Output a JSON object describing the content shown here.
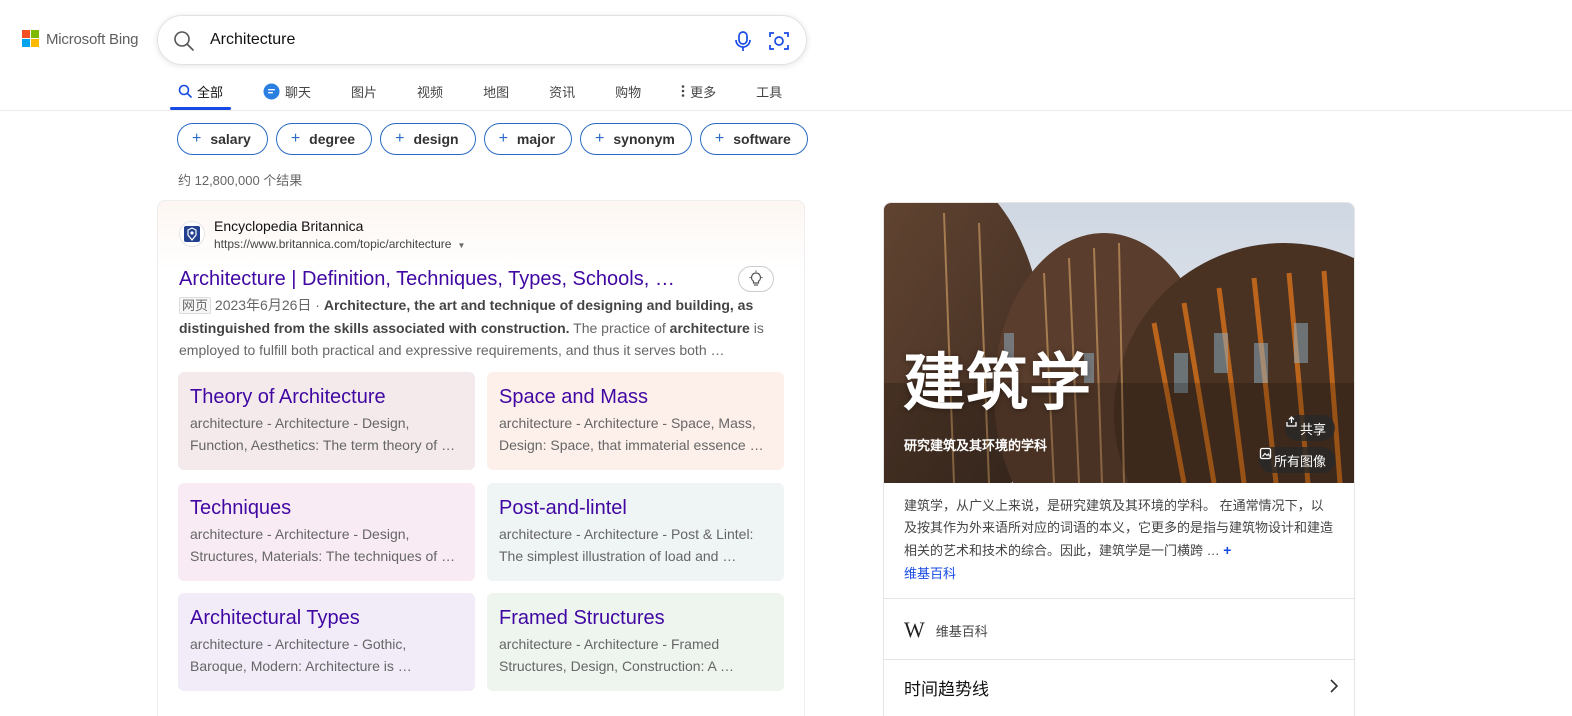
{
  "header": {
    "logo_text": "Microsoft Bing",
    "search_query": "Architecture"
  },
  "tabs": [
    {
      "label": "全部",
      "active": true,
      "icon": "search-icon"
    },
    {
      "label": "聊天",
      "active": false,
      "icon": "copilot-chat-icon"
    },
    {
      "label": "图片",
      "active": false
    },
    {
      "label": "视频",
      "active": false
    },
    {
      "label": "地图",
      "active": false
    },
    {
      "label": "资讯",
      "active": false
    },
    {
      "label": "购物",
      "active": false
    },
    {
      "label": "更多",
      "active": false,
      "icon": "more-vertical-icon"
    },
    {
      "label": "工具",
      "active": false
    }
  ],
  "refinements": [
    "salary",
    "degree",
    "design",
    "major",
    "synonym",
    "software"
  ],
  "result_count": "约 12,800,000 个结果",
  "result": {
    "site_name": "Encyclopedia Britannica",
    "url": "https://www.britannica.com/topic/architecture",
    "title": "Architecture | Definition, Techniques, Types, Schools, …",
    "label": "网页",
    "date": "2023年6月26日 ·",
    "snippet_bold": "Architecture, the art and technique of designing and building, as distinguished from the skills associated with construction.",
    "snippet_text1": "The practice of",
    "snippet_bold2": "architecture",
    "snippet_text2": "is employed to fulfill both practical and expressive requirements, and thus it serves both …",
    "deeplinks": [
      {
        "title": "Theory of Architecture",
        "desc1": "architecture - Architecture - Design,",
        "desc2": "Function, Aesthetics: The term theory of …"
      },
      {
        "title": "Space and Mass",
        "desc1": "architecture - Architecture - Space, Mass,",
        "desc2": "Design: Space, that immaterial essence …"
      },
      {
        "title": "Techniques",
        "desc1": "architecture - Architecture - Design,",
        "desc2": "Structures, Materials: The techniques of …"
      },
      {
        "title": "Post-and-lintel",
        "desc1": "architecture - Architecture - Post & Lintel:",
        "desc2": "The simplest illustration of load and …"
      },
      {
        "title": "Architectural Types",
        "desc1": "architecture - Architecture - Gothic,",
        "desc2": "Baroque, Modern: Architecture is …"
      },
      {
        "title": "Framed Structures",
        "desc1": "architecture - Architecture - Framed",
        "desc2": "Structures, Design, Construction: A …"
      }
    ]
  },
  "knowledge_panel": {
    "title": "建筑学",
    "subtitle": "研究建筑及其环境的学科",
    "share_label": "共享",
    "all_images_label": "所有图像",
    "description": "建筑学，从广义上来说，是研究建筑及其环境的学科。 在通常情况下，以及按其作为外来语所对应的词语的本义，它更多的是指与建筑物设计和建造相关的艺术和技术的综合。因此，建筑学是一门横跨 …",
    "more_symbol": "+",
    "source_link": "维基百科",
    "wiki_glyph": "W",
    "wiki_label": "维基百科",
    "trend_label": "时间趋势线"
  },
  "colors": {
    "accent_blue": "#174ae4",
    "title_purple": "#4007a2"
  }
}
